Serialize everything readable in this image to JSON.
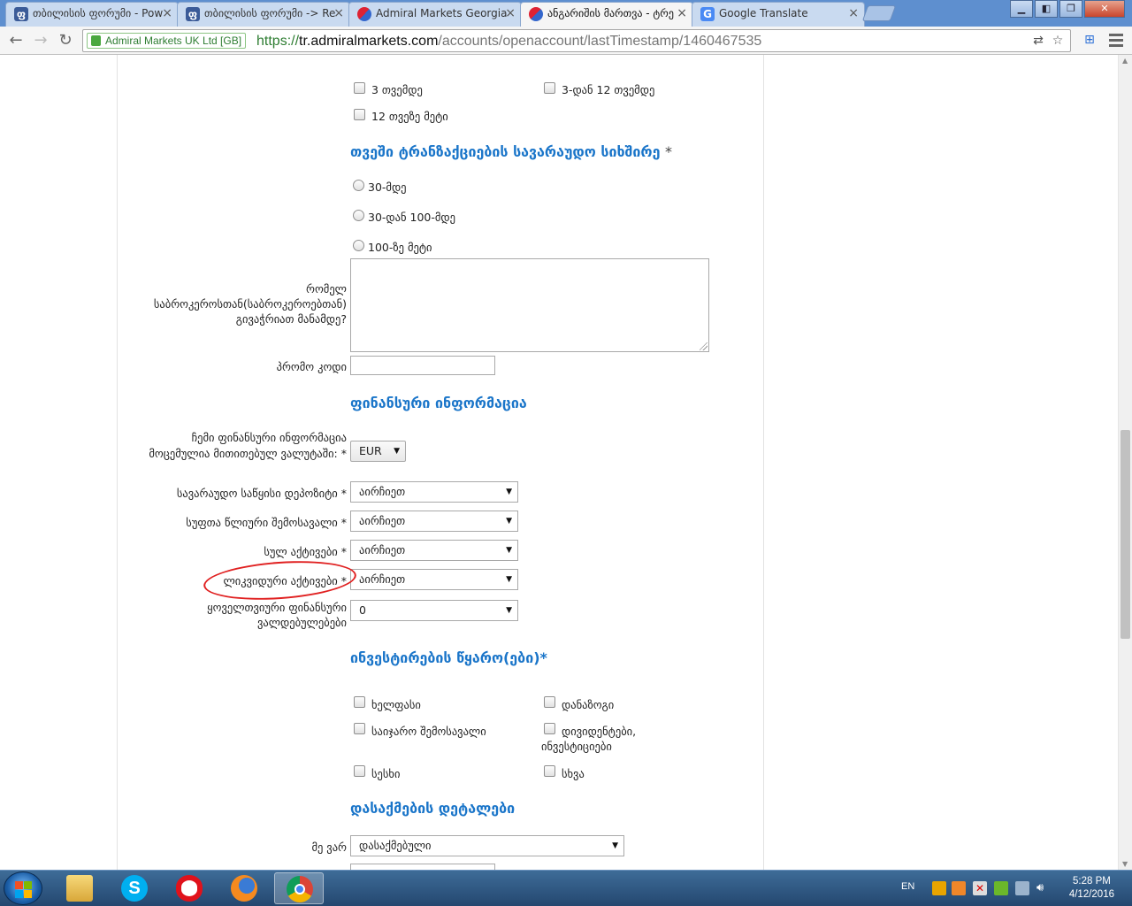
{
  "browser": {
    "tabs": [
      {
        "label": "თბილისის ფორუმი - Pow",
        "favicon": "forum-icon"
      },
      {
        "label": "თბილისის ფორუმი -> Re",
        "favicon": "forum-icon"
      },
      {
        "label": "Admiral Markets Georgia",
        "favicon": "admiral-icon"
      },
      {
        "label": "ანგარიშის მართვა - ტრე",
        "favicon": "admiral-icon"
      },
      {
        "label": "Google Translate",
        "favicon": "google-translate-icon"
      }
    ],
    "ev_certificate": "Admiral Markets UK Ltd [GB]",
    "url_scheme": "https://",
    "url_host": "tr.admiralmarkets.com",
    "url_path": "/accounts/openaccount/lastTimestamp/1460467535"
  },
  "form": {
    "experience_options": [
      "3 თვემდე",
      "3-დან 12 თვემდე",
      "12 თვეზე მეტი"
    ],
    "transactions_heading": "თვეში ტრანზაქციების სავარაუდო სიხშირე",
    "required_mark": "*",
    "transaction_options": [
      "30-მდე",
      "30-დან 100-მდე",
      "100-ზე მეტი"
    ],
    "broker_label": "რომელ საბროკეროსთან(საბროკეროებთან) გივაჭრიათ მანამდე?",
    "promo_label": "პრომო კოდი",
    "financial_heading": "ფინანსური ინფორმაცია",
    "currency_label": "ჩემი ფინანსური ინფორმაცია მოცემულია მითითებულ ვალუტაში:",
    "currency_value": "EUR",
    "deposit_label": "სავარაუდო საწყისი დეპოზიტი",
    "income_label": "სუფთა წლიური შემოსავალი",
    "assets_label": "სულ აქტივები",
    "liquid_label": "ლიკვიდური აქტივები",
    "liabilities_label": "ყოველთვიური ფინანსური ვალდებულებები",
    "select_placeholder": "აირჩიეთ",
    "liabilities_value": "0",
    "sources_heading": "ინვესტირების წყარო(ები)*",
    "sources": [
      "ხელფასი",
      "დანაზოგი",
      "საიჯარო შემოსავალი",
      "დივიდენტები, ინვესტიციები",
      "სესხი",
      "სხვა"
    ],
    "employment_heading": "დასაქმების დეტალები",
    "employment_label": "მე ვარ",
    "employment_value": "დასაქმებული"
  },
  "taskbar": {
    "language": "EN",
    "time": "5:28 PM",
    "date": "4/12/2016"
  },
  "colors": {
    "heading": "#1a75c9",
    "annotation": "#e02020",
    "titlebar": "#5e8fcf"
  }
}
